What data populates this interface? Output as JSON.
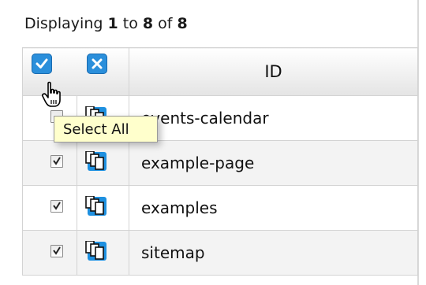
{
  "display": {
    "prefix": "Displaying ",
    "start": "1",
    "mid": " to ",
    "end": "8",
    "of": " of ",
    "total": "8"
  },
  "table": {
    "header_id": "ID",
    "rows": [
      {
        "id": "events-calendar",
        "checked": false
      },
      {
        "id": "example-page",
        "checked": true
      },
      {
        "id": "examples",
        "checked": true
      },
      {
        "id": "sitemap",
        "checked": true
      }
    ]
  },
  "tooltip": {
    "text": "Select All"
  },
  "icons": {
    "select_all": "check-icon",
    "deselect_all": "x-icon",
    "page_copies": "pages-icon",
    "cursor": "hand-pointer-icon"
  },
  "colors": {
    "accent": "#2b8fdb",
    "tooltip_bg": "#ffffcc",
    "alt_row": "#f3f3f3"
  }
}
